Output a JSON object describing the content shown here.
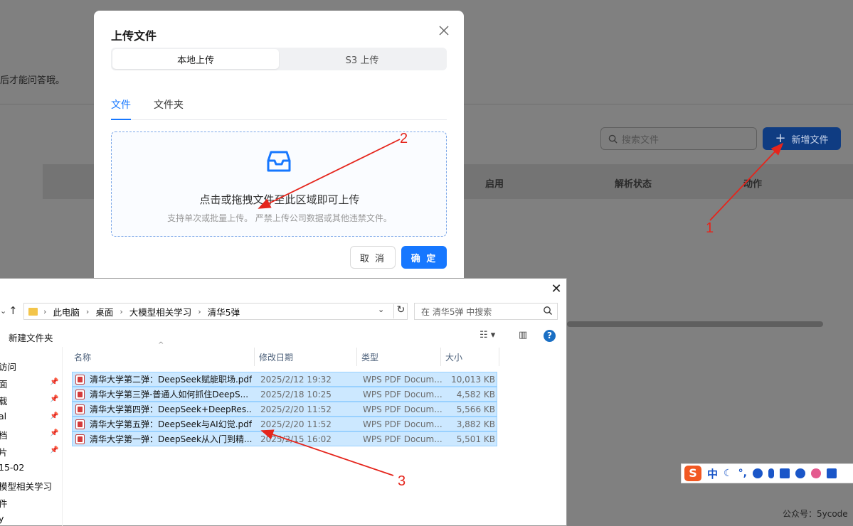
{
  "background": {
    "hint_text": "后才能问答哦。",
    "search_placeholder": "搜索文件",
    "new_file_button": "新增文件",
    "columns": [
      "启用",
      "解析状态",
      "动作"
    ]
  },
  "upload_modal": {
    "title": "上传文件",
    "segments": [
      "本地上传",
      "S3 上传"
    ],
    "tabs": [
      "文件",
      "文件夹"
    ],
    "drop_main": "点击或拖拽文件至此区域即可上传",
    "drop_sub": "支持单次或批量上传。 严禁上传公司数据或其他违禁文件。",
    "cancel": "取 消",
    "ok": "确 定",
    "accent": "#1677ff"
  },
  "explorer": {
    "breadcrumbs": [
      "此电脑",
      "桌面",
      "大模型相关学习",
      "清华5弹"
    ],
    "search_placeholder": "在 清华5弹 中搜索",
    "new_folder": "新建文件夹",
    "help": "?",
    "nav_items": [
      "访问",
      "面",
      "载",
      "al",
      "档",
      "片",
      "15-02",
      "模型相关学习",
      "件",
      "y"
    ],
    "columns": [
      "名称",
      "修改日期",
      "类型",
      "大小"
    ],
    "files": [
      {
        "name": "清华大学第二弹：DeepSeek赋能职场.pdf",
        "date": "2025/2/12 19:32",
        "type": "WPS PDF Docum...",
        "size": "10,013 KB"
      },
      {
        "name": "清华大学第三弹-普通人如何抓住DeepS...",
        "date": "2025/2/18 10:25",
        "type": "WPS PDF Docum...",
        "size": "4,582 KB"
      },
      {
        "name": "清华大学第四弹：DeepSeek+DeepRes...",
        "date": "2025/2/20 11:52",
        "type": "WPS PDF Docum...",
        "size": "5,566 KB"
      },
      {
        "name": "清华大学第五弹：DeepSeek与AI幻觉.pdf",
        "date": "2025/2/20 11:52",
        "type": "WPS PDF Docum...",
        "size": "3,882 KB"
      },
      {
        "name": "清华大学第一弹：DeepSeek从入门到精...",
        "date": "2025/2/15 16:02",
        "type": "WPS PDF Docum...",
        "size": "5,501 KB"
      }
    ]
  },
  "annotations": [
    "1",
    "2",
    "3"
  ],
  "ime": {
    "logo": "S",
    "mode": "中"
  },
  "watermark": "公众号：5ycode"
}
